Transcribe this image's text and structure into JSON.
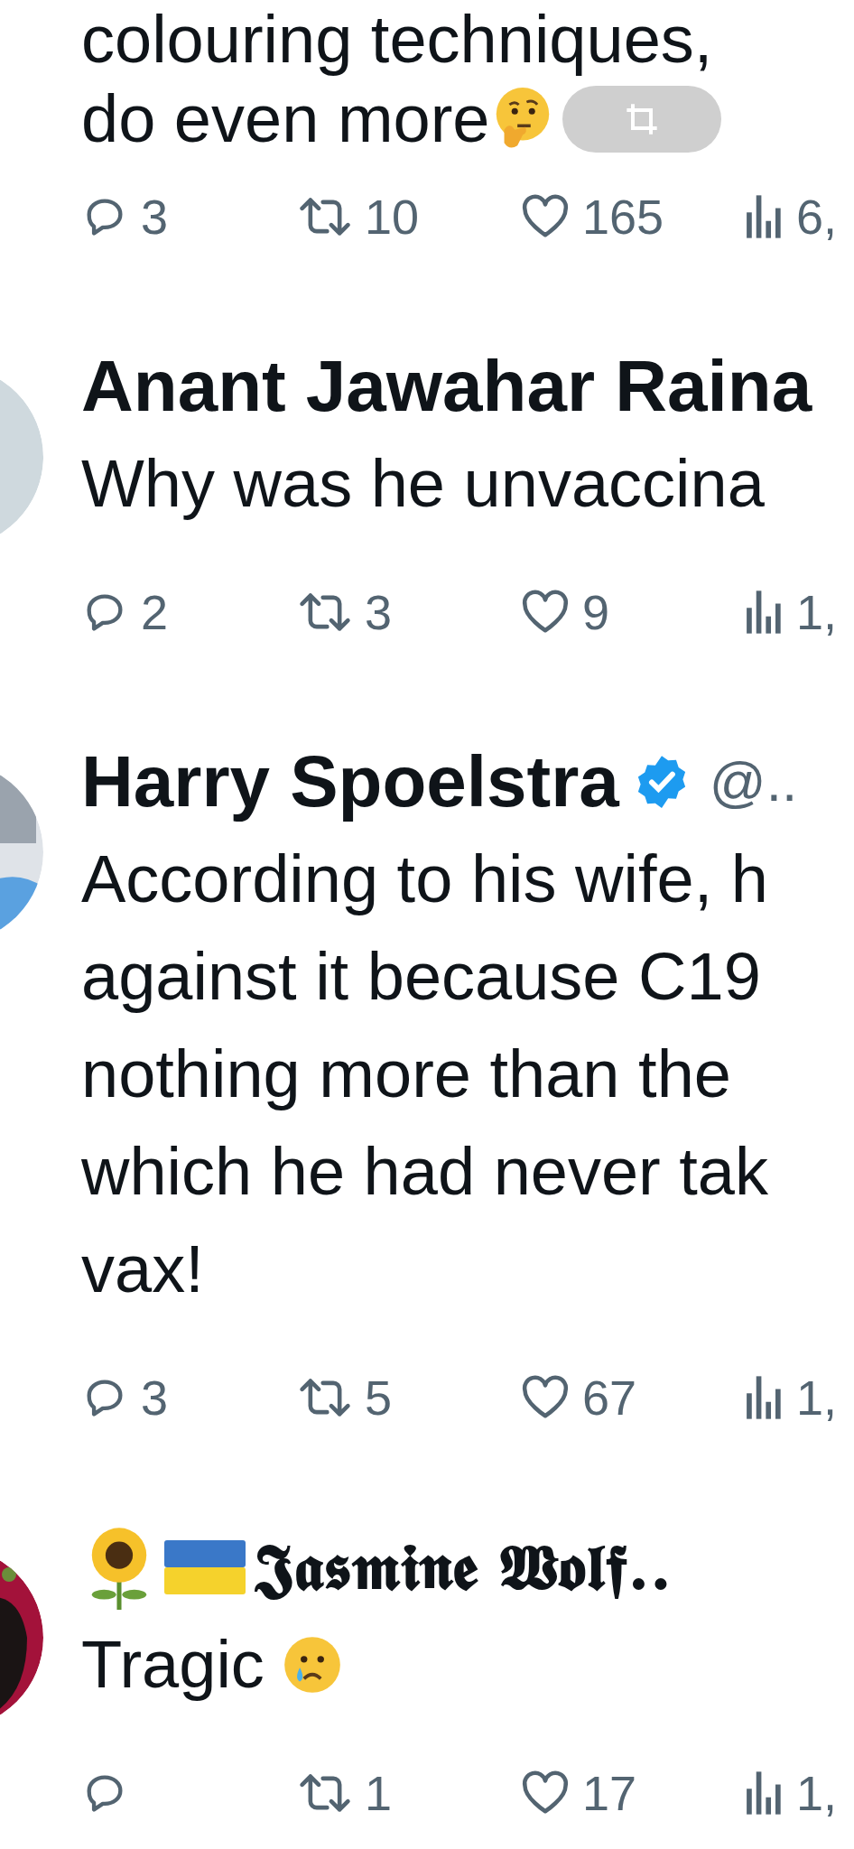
{
  "tweets": [
    {
      "lines": [
        "colouring techniques,",
        "do even more"
      ],
      "actions": {
        "replies": "3",
        "reposts": "10",
        "likes": "165",
        "views": "6,"
      }
    },
    {
      "author": "Anant Jawahar Raina",
      "verified": false,
      "lines": [
        "Why was he unvaccina"
      ],
      "actions": {
        "replies": "2",
        "reposts": "3",
        "likes": "9",
        "views": "1,"
      }
    },
    {
      "author": "Harry Spoelstra",
      "verified": true,
      "handle": "@..",
      "lines": [
        "According to his wife, h",
        "against it because C19",
        "nothing more than the",
        "which he had never tak",
        "vax!"
      ],
      "actions": {
        "replies": "3",
        "reposts": "5",
        "likes": "67",
        "views": "1,"
      }
    },
    {
      "author": "𝕵𝖆𝖘𝖒𝖎𝖓𝖊 𝖂𝖔𝖑𝖋..",
      "verified": false,
      "lines": [
        "Tragic"
      ],
      "actions": {
        "reposts": "1",
        "likes": "17",
        "views": "1,"
      }
    }
  ]
}
